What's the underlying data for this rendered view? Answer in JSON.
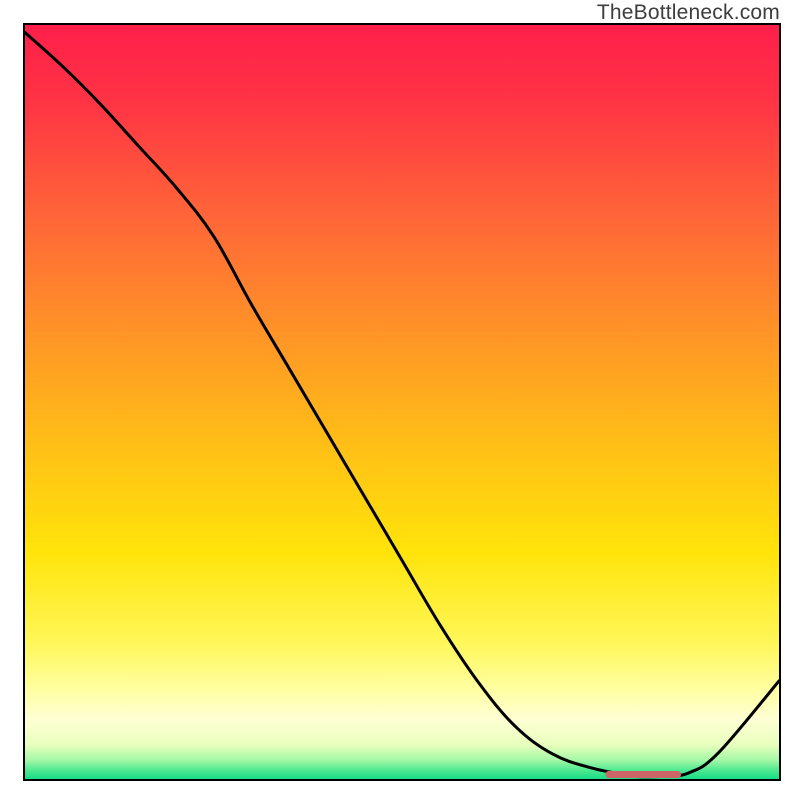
{
  "attribution": "TheBottleneck.com",
  "chart_data": {
    "type": "line",
    "title": "",
    "xlabel": "",
    "ylabel": "",
    "xlim": [
      0,
      100
    ],
    "ylim": [
      0,
      100
    ],
    "x": [
      0,
      5,
      10,
      15,
      20,
      25,
      30,
      35,
      40,
      45,
      50,
      55,
      60,
      65,
      70,
      75,
      80,
      82,
      85,
      88,
      92,
      100
    ],
    "y": [
      99,
      94.5,
      89.5,
      84,
      78.5,
      72,
      63,
      54.5,
      46,
      37.5,
      29,
      20.5,
      13,
      7,
      3.3,
      1.5,
      0.5,
      0.3,
      0.4,
      0.8,
      3.5,
      13
    ],
    "optimal_band": {
      "x_start": 77,
      "x_end": 87,
      "color": "#cc6666"
    },
    "gradient_stops": [
      {
        "offset": 0.0,
        "color": "#ff1f4a"
      },
      {
        "offset": 0.1,
        "color": "#ff3345"
      },
      {
        "offset": 0.25,
        "color": "#ff6438"
      },
      {
        "offset": 0.4,
        "color": "#ff9128"
      },
      {
        "offset": 0.55,
        "color": "#ffbd17"
      },
      {
        "offset": 0.7,
        "color": "#ffe40a"
      },
      {
        "offset": 0.82,
        "color": "#fff75a"
      },
      {
        "offset": 0.88,
        "color": "#ffffa0"
      },
      {
        "offset": 0.92,
        "color": "#ffffd4"
      },
      {
        "offset": 0.955,
        "color": "#e8ffbd"
      },
      {
        "offset": 0.975,
        "color": "#a4f8a6"
      },
      {
        "offset": 0.99,
        "color": "#45e78f"
      },
      {
        "offset": 1.0,
        "color": "#18dd87"
      }
    ]
  }
}
